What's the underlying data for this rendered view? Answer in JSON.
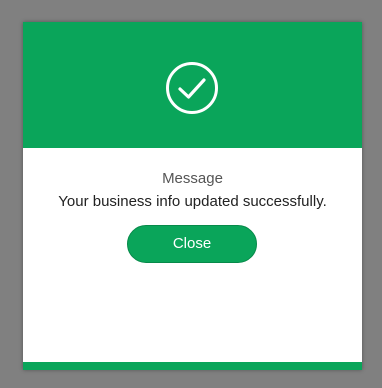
{
  "dialog": {
    "icon": "check-circle-icon",
    "title": "Message",
    "message": "Your business info updated successfully.",
    "close_label": "Close"
  },
  "colors": {
    "accent": "#0aa55a",
    "backdrop": "#808080",
    "panel": "#ffffff"
  }
}
